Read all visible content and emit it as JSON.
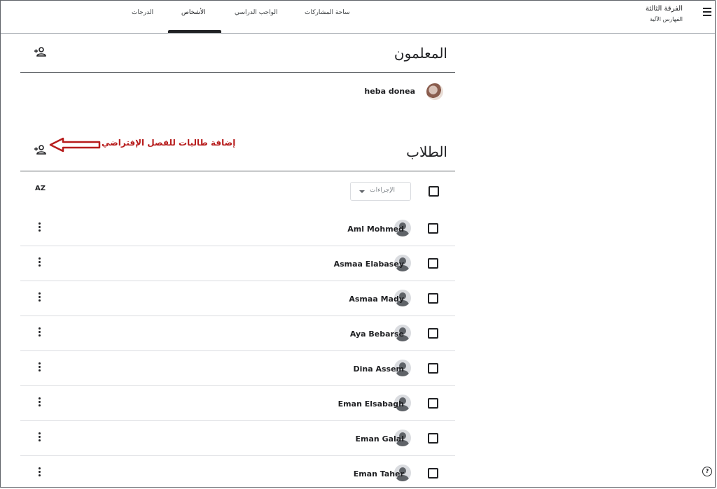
{
  "header": {
    "class_name": "الفرقة الثالثة",
    "class_subtitle": "الفهارس الآلية",
    "tabs": [
      {
        "label": "ساحة المشاركات"
      },
      {
        "label": "الواجب الدراسي"
      },
      {
        "label": "الأشخاص"
      },
      {
        "label": "الدرجات"
      }
    ],
    "active_tab": "الأشخاص"
  },
  "teachers": {
    "title": "المعلمون",
    "list": [
      {
        "name": "heba donea"
      }
    ]
  },
  "students": {
    "title": "الطلاب",
    "annotation": "إضافة طالبات للفصل الإفتراضي",
    "actions_label": "الإجراءات",
    "sort_label": "AZ",
    "list": [
      {
        "name": "Aml Mohmed"
      },
      {
        "name": "Asmaa Elabasey"
      },
      {
        "name": "Asmaa Mady"
      },
      {
        "name": "Aya Bebarse"
      },
      {
        "name": "Dina Assem"
      },
      {
        "name": "Eman Elsabagh"
      },
      {
        "name": "Eman Galal"
      },
      {
        "name": "Eman Taher"
      }
    ]
  },
  "colors": {
    "annotation": "#b71c1c",
    "text": "#202124",
    "divider": "#dadce0"
  },
  "icons": [
    "menu-icon",
    "add-person-icon",
    "sort-az-icon",
    "more-vert-icon",
    "avatar-icon",
    "help-icon",
    "arrow-icon"
  ]
}
